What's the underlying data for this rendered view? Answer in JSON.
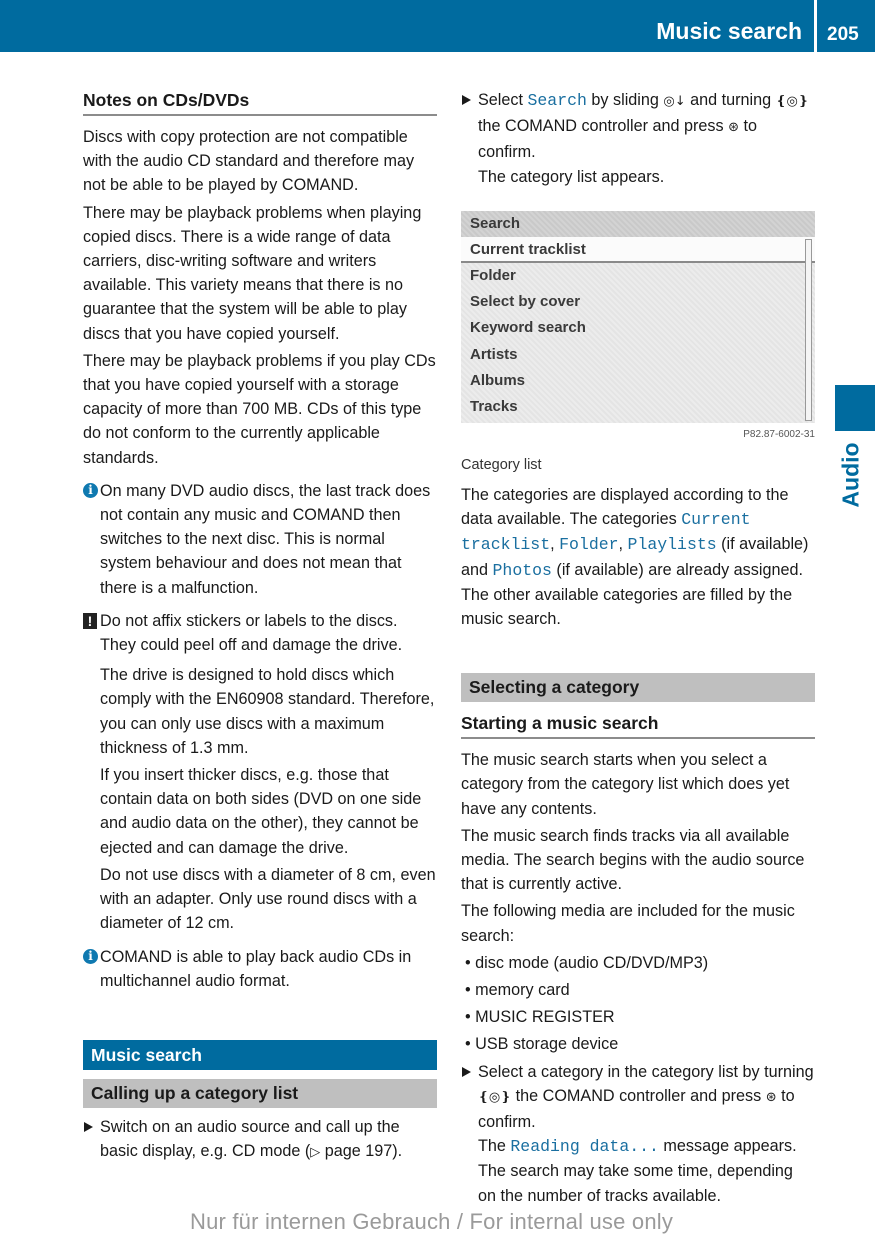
{
  "header": {
    "section_title": "Music search",
    "page_number": "205",
    "color": "#006b9f"
  },
  "side_tab": {
    "label": "Audio"
  },
  "left": {
    "notes_heading": "Notes on CDs/DVDs",
    "paragraphs": [
      "Discs with copy protection are not compatible with the audio CD standard and therefore may not be able to be played by COMAND.",
      "There may be playback problems when playing copied discs. There is a wide range of data carriers, disc-writing software and writers available. This variety means that there is no guarantee that the system will be able to play discs that you have copied yourself.",
      "There may be playback problems if you play CDs that you have copied yourself with a storage capacity of more than 700 MB. CDs of this type do not conform to the currently applicable standards."
    ],
    "info1": "On many DVD audio discs, the last track does not contain any music and COMAND then switches to the next disc. This is normal system behaviour and does not mean that there is a malfunction.",
    "warning_lead": "Do not affix stickers or labels to the discs. They could peel off and damage the drive.",
    "warning_paras": [
      "The drive is designed to hold discs which comply with the EN60908 standard. Therefore, you can only use discs with a maximum thickness of 1.3 mm.",
      "If you insert thicker discs, e.g. those that contain data on both sides (DVD on one side and audio data on the other), they cannot be ejected and can damage the drive.",
      "Do not use discs with a diameter of 8 cm, even with an adapter. Only use round discs with a diameter of 12 cm."
    ],
    "info2": "COMAND is able to play back audio CDs in multichannel audio format.",
    "section_heading": "Music search",
    "subsection_heading": "Calling up a category list",
    "step1": "Switch on an audio source and call up the basic display, e.g. CD mode (",
    "step1_ref_icon": "▷",
    "step1_ref": " page 197)."
  },
  "right": {
    "step2": {
      "select": "Select ",
      "search": "Search",
      "slide": " by sliding ",
      "slide_icon": "◎↓",
      "turn": " and turning ",
      "turn_icon": "❴◎❵",
      "controller": " the COMAND controller and press ",
      "press_icon": "⊛",
      "confirm": " to confirm.",
      "result": "The category list appears."
    },
    "screenshot": {
      "header": "Search",
      "items": [
        "Current tracklist",
        "Folder",
        "Select by cover",
        "Keyword search",
        "Artists",
        "Albums",
        "Tracks"
      ],
      "selected_index": 0,
      "code": "P82.87-6002-31"
    },
    "caption": "Category list",
    "cat_para": {
      "t1": "The categories are displayed according to the data available. The categories ",
      "c1": "Current tracklist",
      "t2": ", ",
      "c2": "Folder",
      "t3": ", ",
      "c3": "Playlists",
      "t4": " (if available) and ",
      "c4": "Photos",
      "t5": " (if available) are already assigned. The other available categories are filled by the music search."
    },
    "section_heading": "Selecting a category",
    "sub_heading": "Starting a music search",
    "paras": [
      "The music search starts when you select a category from the category list which does yet have any contents.",
      "The music search finds tracks via all available media. The search begins with the audio source that is currently active.",
      "The following media are included for the music search:"
    ],
    "bullets": [
      "disc mode (audio CD/DVD/MP3)",
      "memory card",
      "MUSIC REGISTER",
      "USB storage device"
    ],
    "step3": {
      "a": "Select a category in the category list by turning ",
      "turn_icon": "❴◎❵",
      "b": " the COMAND controller and press ",
      "press_icon": "⊛",
      "c": " to confirm.",
      "d": "The ",
      "msg": "Reading data...",
      "e": " message appears.",
      "f": "The search may take some time, depending on the number of tracks available."
    }
  },
  "footer": {
    "watermark": "Nur für internen Gebrauch / For internal use only"
  }
}
